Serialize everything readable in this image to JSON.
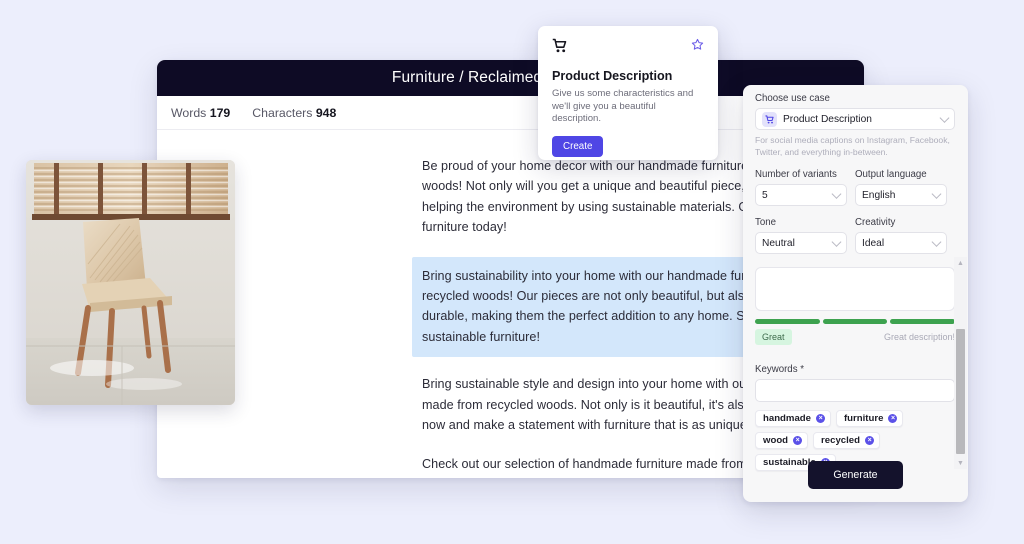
{
  "background_color": "#ECEEFC",
  "editor": {
    "title": "Furniture / Reclaimed Wood Chair",
    "stats": {
      "words_label": "Words",
      "words_value": "179",
      "characters_label": "Characters",
      "characters_value": "948"
    },
    "paragraphs": [
      {
        "text": "Be proud of your home decor with our handmade furniture made from recycled woods! Not only will you get a unique and beautiful piece, but you'll also be helping the environment by using sustainable materials. Get your one-of-a-kind furniture today!",
        "highlighted": false
      },
      {
        "text": "Bring sustainability into your home with our handmade furniture made from recycled woods! Our pieces are not only beautiful, but also eco-friendly and durable, making them the perfect addition to any home. Shop now for stylish, sustainable furniture!",
        "highlighted": true
      },
      {
        "text": "Bring sustainable style and design into your home with our handmade furniture made from recycled woods. Not only is it beautiful, it's also eco-friendly! Shop now and make a statement with furniture that is as unique as you are.",
        "highlighted": false
      },
      {
        "text": "Check out our selection of handmade furniture made from recycled woods. Not only are these pieces beautiful, but they're also sustainable and eco-friendly. Invest in quality, timeless furniture that you can proudly show off for years to come!",
        "highlighted": false
      }
    ],
    "highlight_color": "#D3E7FB",
    "header_color": "#0E0B25"
  },
  "photo": {
    "alt": "Wooden chair in front of window blinds"
  },
  "popup_card": {
    "cart_icon": "shopping-cart-icon",
    "star_icon": "star-outline-icon",
    "title": "Product Description",
    "description": "Give us some characteristics and we'll give you a beautiful description.",
    "button_label": "Create",
    "button_color": "#4F46E5"
  },
  "side_panel": {
    "use_case": {
      "label": "Choose use case",
      "value": "Product Description",
      "icon": "shopping-cart-icon",
      "help_text": "For social media captions on Instagram, Facebook, Twitter, and everything in-between."
    },
    "variants": {
      "label": "Number of variants",
      "value": "5"
    },
    "language": {
      "label": "Output language",
      "value": "English"
    },
    "tone": {
      "label": "Tone",
      "value": "Neutral"
    },
    "creativity": {
      "label": "Creativity",
      "value": "Ideal"
    },
    "description_input": {
      "value": "",
      "placeholder": ""
    },
    "quality": {
      "segments_filled": 3,
      "segments_total": 3,
      "badge": "Great",
      "note": "Great description!",
      "bar_color": "#3DA24F",
      "badge_bg": "#D6F5E0"
    },
    "keywords": {
      "label": "Keywords *",
      "input_value": "",
      "tags": [
        "handmade",
        "furniture",
        "wood",
        "recycled",
        "sustainable"
      ],
      "remove_icon": "close-circle-icon",
      "remove_color": "#5B51E8"
    },
    "generate_button": {
      "label": "Generate",
      "color": "#14122C"
    },
    "scrollbar": {
      "up_icon": "chevron-up-icon",
      "down_icon": "chevron-down-icon"
    }
  }
}
